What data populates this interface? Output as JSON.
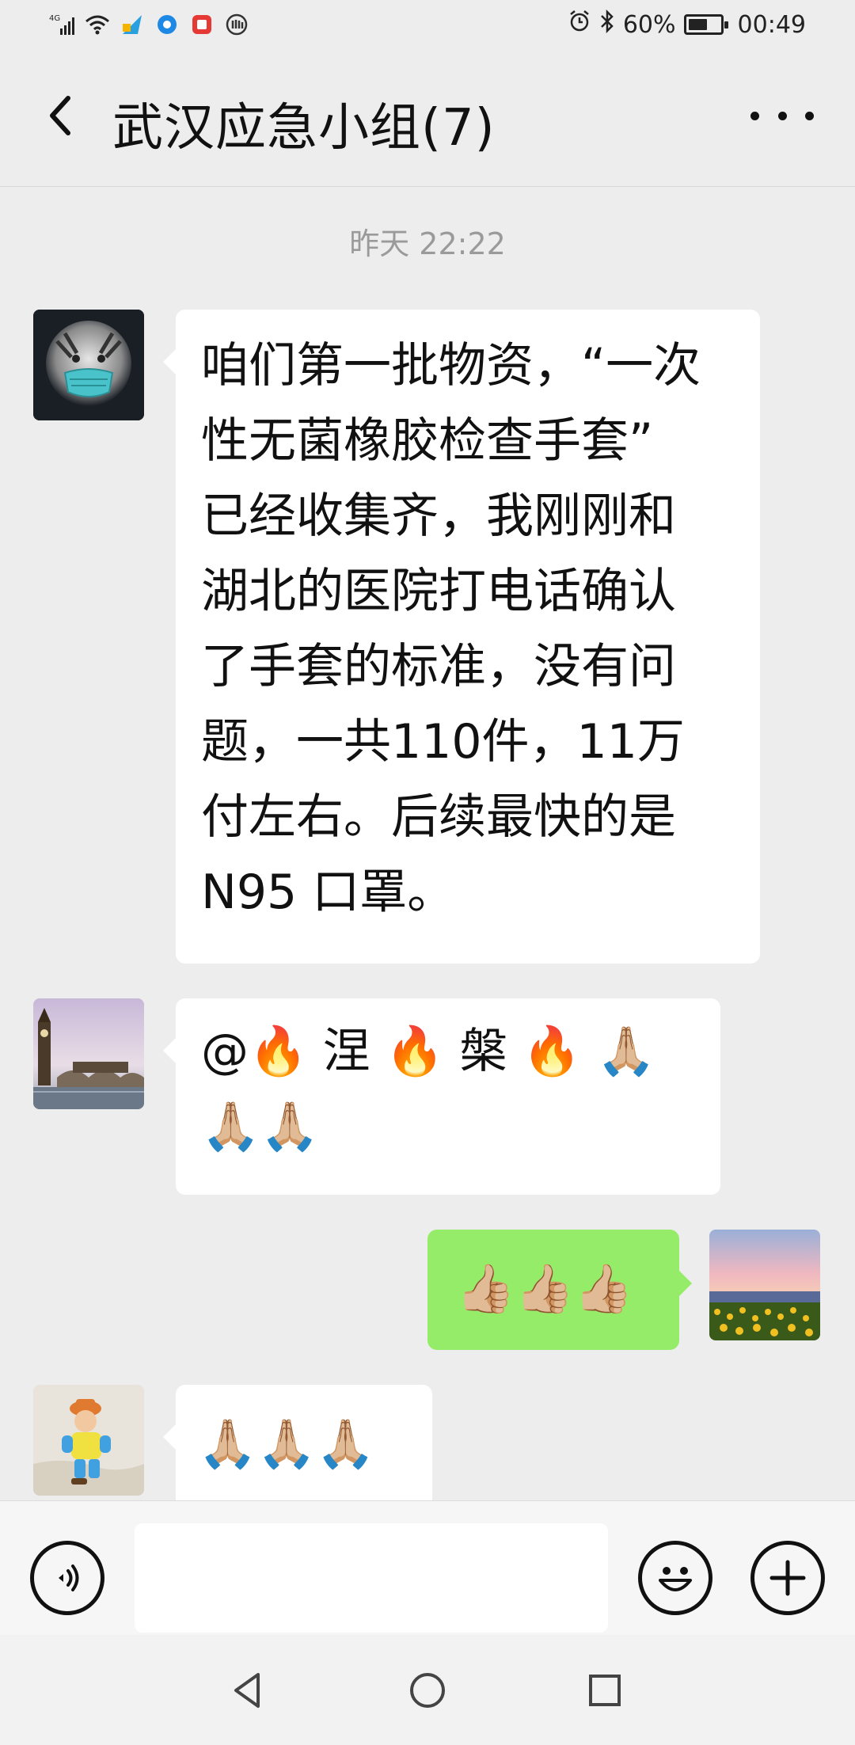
{
  "status_bar": {
    "network": "4G",
    "battery": "60%",
    "battery_level": 0.6,
    "time": "00:49",
    "icons": [
      "signal-icon",
      "wifi-icon",
      "app-icon",
      "app-icon",
      "app-icon",
      "app-icon",
      "alarm-icon",
      "bluetooth-icon",
      "battery-icon"
    ]
  },
  "header": {
    "title": "武汉应急小组(7)",
    "back_icon": "chevron-left-icon",
    "more_icon": "more-icon"
  },
  "chat": {
    "timestamp": "昨天 22:22",
    "messages": [
      {
        "side": "left",
        "avatar": "tiger-mask-avatar",
        "lines": [
          "咱们第一批物资，“一次",
          "性无菌橡胶检查手套”",
          "已经收集齐，我刚刚和",
          "湖北的医院打电话确认",
          "了手套的标准，没有问",
          "题，一共110件，11万",
          "付左右。后续最快的是",
          "N95 口罩。"
        ]
      },
      {
        "side": "left",
        "avatar": "big-ben-avatar",
        "lines": [
          "@🔥 涅 🔥 槃 🔥 🙏🏼",
          "🙏🏼🙏🏼"
        ]
      },
      {
        "side": "right",
        "avatar": "sunflower-avatar",
        "lines": [
          "👍🏼👍🏼👍🏼"
        ]
      },
      {
        "side": "left",
        "avatar": "child-avatar",
        "lines": [
          "🙏🏼🙏🏼🙏🏼"
        ]
      }
    ]
  },
  "input_bar": {
    "voice_icon": "voice-icon",
    "emoji_icon": "emoji-icon",
    "plus_icon": "plus-icon",
    "input_value": ""
  },
  "nav_bar": {
    "back": "nav-back-icon",
    "home": "nav-home-icon",
    "recents": "nav-recents-icon"
  }
}
